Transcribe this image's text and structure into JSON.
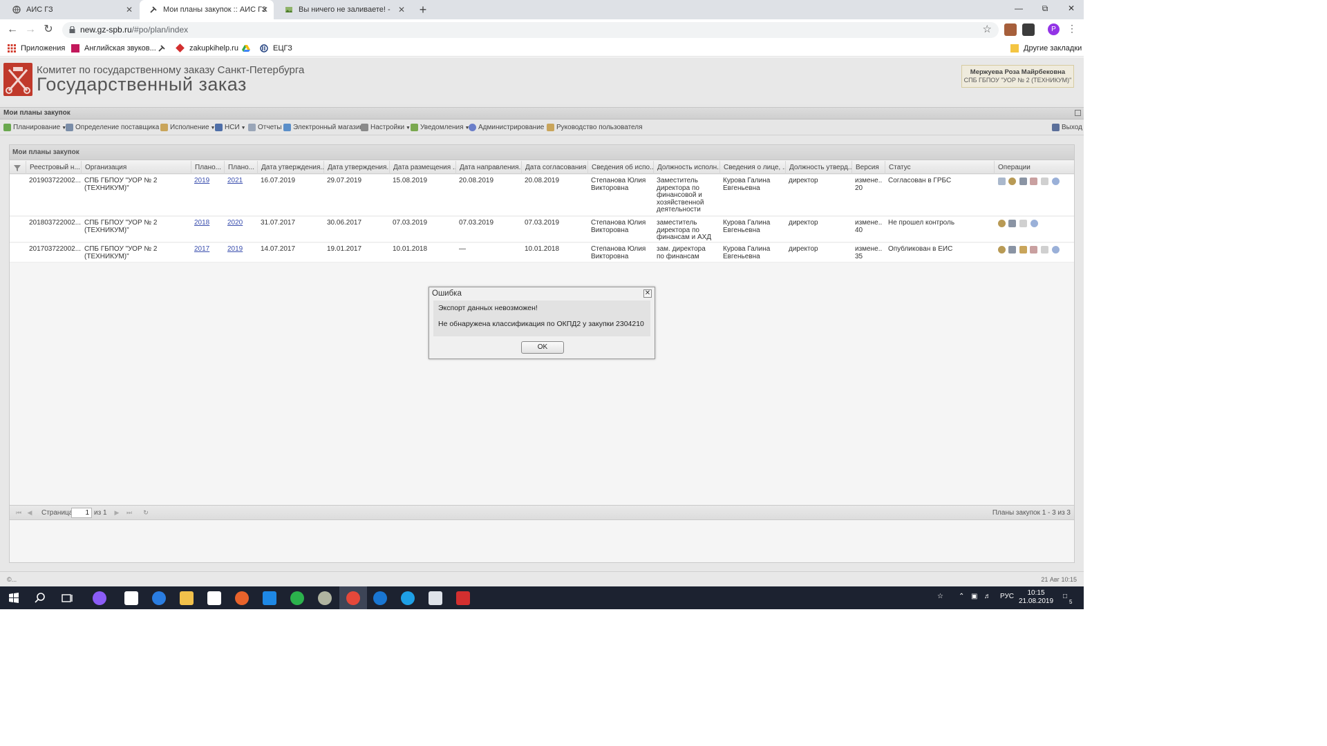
{
  "browser": {
    "tabs": [
      {
        "title": "АИС ГЗ",
        "close": "✕"
      },
      {
        "title": "Мои планы закупок :: АИС ГЗ",
        "close": "✕"
      },
      {
        "title": "Вы ничего не заливаете! - Pictu",
        "close": "✕"
      }
    ],
    "new_tab": "+",
    "url_host": "new.gz-spb.ru",
    "url_path": "/#po/plan/index",
    "profile_letter": "P",
    "bookmarks": [
      {
        "label": "Приложения"
      },
      {
        "label": "Английская звуков..."
      },
      {
        "label": ""
      },
      {
        "label": "zakupkihelp.ru"
      },
      {
        "label": ""
      },
      {
        "label": "ЕЦГЗ"
      }
    ],
    "other_bookmarks": "Другие закладки"
  },
  "header": {
    "org": "Комитет по государственному заказу Санкт-Петербурга",
    "title": "Государственный заказ",
    "user_name": "Мержуева Роза Майрбековна",
    "user_org": "СПБ ГБПОУ \"УОР № 2 (ТЕХНИКУМ)\""
  },
  "panel_title": "Мои планы закупок",
  "toolbar": [
    {
      "label": "Планирование",
      "dropdown": true,
      "color": "#6aa84f"
    },
    {
      "label": "Определение поставщика",
      "dropdown": true,
      "color": "#7a8da8"
    },
    {
      "label": "Исполнение",
      "dropdown": true,
      "color": "#c9a55b"
    },
    {
      "label": "НСИ",
      "dropdown": true,
      "color": "#4f6fa8"
    },
    {
      "label": "Отчеты",
      "dropdown": false,
      "color": "#9aa6b8"
    },
    {
      "label": "Электронный магазин",
      "dropdown": false,
      "color": "#5b8fc9"
    },
    {
      "label": "Настройки",
      "dropdown": true,
      "color": "#8a8a8a"
    },
    {
      "label": "Уведомления",
      "dropdown": true,
      "color": "#7aa84f"
    },
    {
      "label": "Администрирование",
      "dropdown": true,
      "color": "#6a7ec9"
    },
    {
      "label": "Руководство пользователя",
      "dropdown": false,
      "color": "#c9a55b"
    }
  ],
  "exit_label": "Выход",
  "grid": {
    "title": "Мои планы закупок",
    "columns": [
      "Реестровый н...",
      "Организация",
      "Плано...",
      "Плано...",
      "Дата утверждения...",
      "Дата утверждения...",
      "Дата размещения ...",
      "Дата направления...",
      "Дата согласования",
      "Сведения об испо...",
      "Должность исполн...",
      "Сведения о лице, ...",
      "Должность утверд...",
      "Версия",
      "Статус",
      "Операции"
    ],
    "rows": [
      {
        "reg": "201903722002...",
        "org": "СПБ ГБПОУ \"УОР № 2 (ТЕХНИКУМ)\"",
        "p1": "2019",
        "p2": "2021",
        "d1": "16.07.2019",
        "d2": "29.07.2019",
        "d3": "15.08.2019",
        "d4": "20.08.2019",
        "d5": "20.08.2019",
        "exec": "Степанова Юлия Викторовна",
        "exec_pos": "Заместитель директора по финансовой и хозяйственной деятельности",
        "appr": "Курова Галина Евгеньевна",
        "appr_pos": "директор",
        "ver": "измене... 20",
        "status": "Согласован в ГРБС"
      },
      {
        "reg": "201803722002...",
        "org": "СПБ ГБПОУ \"УОР № 2 (ТЕХНИКУМ)\"",
        "p1": "2018",
        "p2": "2020",
        "d1": "31.07.2017",
        "d2": "30.06.2017",
        "d3": "07.03.2019",
        "d4": "07.03.2019",
        "d5": "07.03.2019",
        "exec": "Степанова Юлия Викторовна",
        "exec_pos": "заместитель директора по финансам и АХД",
        "appr": "Курова Галина Евгеньевна",
        "appr_pos": "директор",
        "ver": "измене... 40",
        "status": "Не прошел контроль"
      },
      {
        "reg": "201703722002...",
        "org": "СПБ ГБПОУ \"УОР № 2 (ТЕХНИКУМ)\"",
        "p1": "2017",
        "p2": "2019",
        "d1": "14.07.2017",
        "d2": "19.01.2017",
        "d3": "10.01.2018",
        "d4": "—",
        "d5": "10.01.2018",
        "exec": "Степанова Юлия Викторовна",
        "exec_pos": "зам. директора по финансам",
        "appr": "Курова Галина Евгеньевна",
        "appr_pos": "директор",
        "ver": "измене... 35",
        "status": "Опубликован в ЕИС"
      }
    ]
  },
  "pager": {
    "page_label": "Страница",
    "page_value": "1",
    "of_label": "из 1",
    "summary": "Планы закупок 1 - 3 из 3"
  },
  "statusbar": {
    "left": "©...",
    "right": "21 Авг 10:15"
  },
  "dialog": {
    "title": "Ошибка",
    "close": "✕",
    "line1": "Экспорт данных невозможен!",
    "line2": "Не обнаружена классификация по ОКПД2 у закупки 2304210",
    "ok": "OK"
  },
  "taskbar": {
    "lang": "РУС",
    "time": "10:15",
    "date": "21.08.2019",
    "notif_count": "5"
  }
}
